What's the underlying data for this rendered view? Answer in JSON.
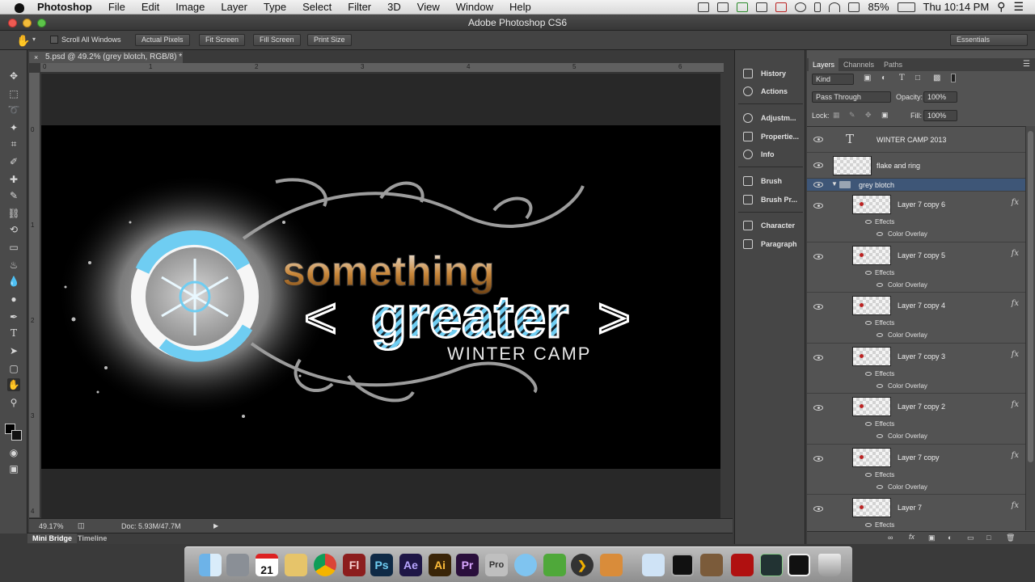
{
  "menubar": {
    "app_name": "Photoshop",
    "items": [
      "File",
      "Edit",
      "Image",
      "Layer",
      "Type",
      "Select",
      "Filter",
      "3D",
      "View",
      "Window",
      "Help"
    ],
    "battery": "85%",
    "clock": "Thu 10:14 PM"
  },
  "window": {
    "title": "Adobe Photoshop CS6"
  },
  "options_bar": {
    "scroll_all_windows": "Scroll All Windows",
    "actual_pixels": "Actual Pixels",
    "fit_screen": "Fit Screen",
    "fill_screen": "Fill Screen",
    "print_size": "Print Size",
    "workspace": "Essentials"
  },
  "document": {
    "tab_title": "5.psd @ 49.2% (grey blotch, RGB/8) *",
    "ruler_top": [
      "0",
      "1",
      "2",
      "3",
      "4",
      "5",
      "6"
    ],
    "ruler_left": [
      "0",
      "1",
      "2",
      "3",
      "4"
    ],
    "zoom": "49.17%",
    "doc_size": "Doc: 5.93M/47.7M",
    "artwork": {
      "word1": "something",
      "word2": "greater",
      "left_bracket": "<",
      "right_bracket": ">",
      "subtitle": "WINTER CAMP"
    }
  },
  "bottom_tabs": {
    "mini_bridge": "Mini Bridge",
    "timeline": "Timeline"
  },
  "dock_panels": [
    "History",
    "Actions",
    "Adjustm...",
    "Propertie...",
    "Info",
    "Brush",
    "Brush Pr...",
    "Character",
    "Paragraph"
  ],
  "layers_panel": {
    "tabs": [
      "Layers",
      "Channels",
      "Paths"
    ],
    "kind": "Kind",
    "blend_mode": "Pass Through",
    "opacity_label": "Opacity:",
    "opacity": "100%",
    "lock_label": "Lock:",
    "fill_label": "Fill:",
    "fill": "100%",
    "layers": [
      {
        "name": "WINTER CAMP 2013",
        "type": "text"
      },
      {
        "name": "flake and ring",
        "type": "pixel"
      },
      {
        "name": "grey blotch",
        "type": "group"
      },
      {
        "name": "Layer 7 copy 6",
        "type": "child"
      },
      {
        "name": "Layer 7 copy 5",
        "type": "child"
      },
      {
        "name": "Layer 7 copy 4",
        "type": "child"
      },
      {
        "name": "Layer 7 copy 3",
        "type": "child"
      },
      {
        "name": "Layer 7 copy 2",
        "type": "child"
      },
      {
        "name": "Layer 7 copy",
        "type": "child"
      },
      {
        "name": "Layer 7",
        "type": "child"
      }
    ],
    "effects_label": "Effects",
    "color_overlay_label": "Color Overlay",
    "fx_label": "fx"
  },
  "mac_dock": {
    "apps": [
      "Finder",
      "Preview",
      "Calendar",
      "Notes",
      "Chrome",
      "Fl",
      "Ps",
      "Ae",
      "Ai",
      "Pr",
      "Pro",
      "Messages",
      "Evernote",
      "Plex",
      "Keynote",
      "Mail",
      "Terminal",
      "Photo",
      "Acrobat",
      "Activity",
      "Monitor",
      "Trash"
    ],
    "calendar_day": "21"
  },
  "colors": {
    "accent_blue": "#6fcdf2",
    "bronze": "#c9873a",
    "selected_layer": "#3e5677"
  }
}
